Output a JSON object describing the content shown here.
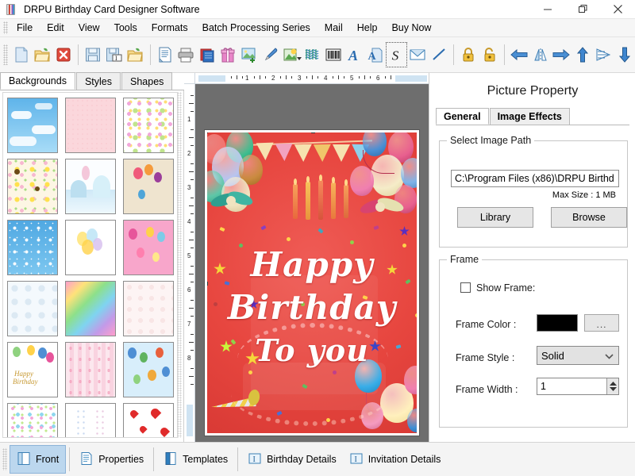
{
  "window": {
    "title": "DRPU Birthday Card Designer Software",
    "app_icon": "book-icon",
    "minimize_label": "Minimize",
    "maximize_label": "Maximize",
    "close_label": "Close"
  },
  "menu": {
    "items": [
      {
        "label": "File"
      },
      {
        "label": "Edit"
      },
      {
        "label": "View"
      },
      {
        "label": "Tools"
      },
      {
        "label": "Formats"
      },
      {
        "label": "Batch Processing Series"
      },
      {
        "label": "Mail"
      },
      {
        "label": "Help"
      },
      {
        "label": "Buy Now"
      }
    ]
  },
  "toolbar": {
    "groups": [
      [
        "new-document-icon",
        "open-folder-icon",
        "close-document-icon"
      ],
      [
        "save-icon",
        "save-as-icon",
        "export-folder-icon"
      ],
      [
        "page-setup-icon",
        "print-icon",
        "card-stack-icon",
        "gift-icon",
        "insert-image-icon",
        "pen-icon",
        "image-gallery-icon",
        "watermark-icon",
        "barcode-icon",
        "text-a-icon",
        "text-on-page-icon",
        "signature-icon",
        "envelope-icon",
        "line-icon"
      ],
      [
        "lock-icon",
        "unlock-icon"
      ],
      [
        "arrow-left-icon",
        "flip-horizontal-icon",
        "arrow-right-icon",
        "arrow-up-icon",
        "align-icon",
        "arrow-down-icon"
      ]
    ]
  },
  "left_panel": {
    "tabs": [
      {
        "label": "Backgrounds",
        "active": true
      },
      {
        "label": "Styles",
        "active": false
      },
      {
        "label": "Shapes",
        "active": false
      }
    ],
    "thumbnails": [
      {
        "name": "sky-clouds"
      },
      {
        "name": "pink-texture"
      },
      {
        "name": "butterflies-flowers"
      },
      {
        "name": "yellow-flowers"
      },
      {
        "name": "pastel-landscape"
      },
      {
        "name": "beige-balloons"
      },
      {
        "name": "blue-stars"
      },
      {
        "name": "white-balloons"
      },
      {
        "name": "pink-party"
      },
      {
        "name": "white-clouds"
      },
      {
        "name": "rainbow-gradient"
      },
      {
        "name": "soft-white-floral"
      },
      {
        "name": "happy-birthday-balloons"
      },
      {
        "name": "pink-stripes-hearts"
      },
      {
        "name": "sky-balloons"
      },
      {
        "name": "pastel-hearts"
      },
      {
        "name": "flower-bouquets"
      },
      {
        "name": "red-hearts"
      }
    ]
  },
  "canvas": {
    "h_ruler_numbers": [
      "1",
      "2",
      "3",
      "4",
      "5",
      "6"
    ],
    "v_ruler_numbers": [
      "1",
      "2",
      "3",
      "4",
      "5",
      "6",
      "7",
      "8"
    ],
    "card": {
      "line1": "Happy",
      "line2": "Birthday",
      "line3": "To you",
      "background_color": "#e84a4a"
    }
  },
  "right_panel": {
    "title": "Picture Property",
    "tabs": [
      {
        "label": "General",
        "active": true
      },
      {
        "label": "Image Effects",
        "active": false
      }
    ],
    "image_path_group": {
      "legend": "Select Image Path",
      "path_value": "C:\\Program Files (x86)\\DRPU Birthd",
      "max_size": "Max Size : 1 MB",
      "library_button": "Library",
      "browse_button": "Browse"
    },
    "frame_group": {
      "legend": "Frame",
      "show_frame_label": "Show Frame:",
      "show_frame_checked": false,
      "frame_color_label": "Frame Color :",
      "frame_color_value": "#000000",
      "frame_color_picker_label": "...",
      "frame_style_label": "Frame Style :",
      "frame_style_value": "Solid",
      "frame_width_label": "Frame Width :",
      "frame_width_value": "1"
    }
  },
  "bottom_bar": {
    "items": [
      {
        "label": "Front",
        "icon": "card-front-icon",
        "active": true
      },
      {
        "label": "Properties",
        "icon": "properties-icon",
        "active": false
      },
      {
        "label": "Templates",
        "icon": "templates-icon",
        "active": false
      },
      {
        "label": "Birthday Details",
        "icon": "text-field-icon",
        "active": false
      },
      {
        "label": "Invitation Details",
        "icon": "text-field-icon",
        "active": false
      }
    ]
  }
}
